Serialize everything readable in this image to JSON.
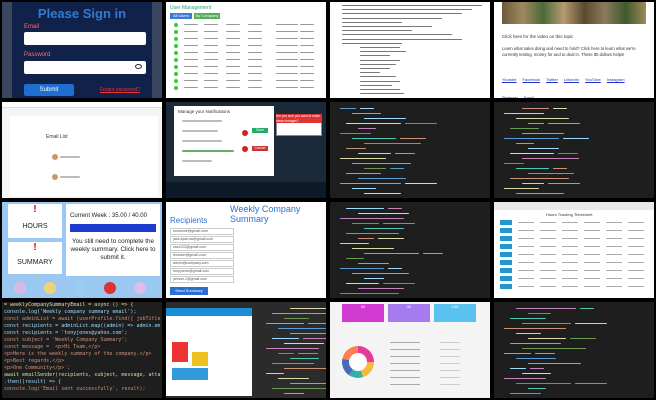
{
  "tiles": {
    "t1": {
      "title": "Please Sign in",
      "email_label": "Email",
      "password_label": "Password",
      "submit": "Submit",
      "link": "Forgot password?"
    },
    "t2": {
      "title": "User Management",
      "tabs": [
        "All Users",
        "By Company"
      ]
    },
    "t4": {
      "caption": "Click here for the video on this topic",
      "body": "Learn what sales doing and need to hold? Click here to learn what we're currently testing, money for and to deal in. These $5 dollars helps!",
      "links": [
        "Youtube",
        "Facebook",
        "Twitter",
        "LinkedIn",
        "YouTube",
        "Instagram",
        "Pinterest",
        "Email"
      ]
    },
    "t5": {
      "title": "Email List"
    },
    "t6": {
      "title": "Manage your Notifications",
      "btn1": "Save",
      "btn2": "Cancel",
      "warning_title": "Are you sure you want to make these changes?"
    },
    "t9": {
      "hours_mark": "!",
      "hours_label": "HOURS",
      "summary_mark": "!",
      "summary_label": "SUMMARY",
      "week_label": "Current Week : 35.00 / 40.00",
      "message": "You still need to complete the weekly summary. Click here to submit it."
    },
    "t10": {
      "title": "Weekly Company Summary",
      "recipients_label": "Recipients",
      "recipients": [
        "someone@gmail.com",
        "jack.sparrow@gmail.com",
        "user123@gmail.com",
        "testuser@gmail.com",
        "admin@company.com",
        "tony.jones@gmail.com",
        "person.1@gmail.com"
      ],
      "send": "Send Summary"
    },
    "t12": {
      "title": "Hours Tracking Timesheet"
    },
    "t13": {
      "code": [
        "= weeklyCompanySummaryEmail = async () => {",
        "console.log('Weekly company summary email');",
        "const adminList = await (userProfile.find({ jobTitle: 'Admi",
        "const recipients = adminList.map((admin) => admin.email);",
        "const recipients = 'tonyjones@yahoo.com';",
        "const subject = 'Weekly Company Summary';",
        "const message = `<p>Hi Team,</p>",
        "<p>Here is the weekly summary of the company.</p>",
        "<p>Best regards,</p>",
        "<p>One Community</p>`;",
        "await emailSender(recipients, subject, message, attachments)",
        ".then((result) => {",
        "  console.log('Email sent successfully', result);"
      ]
    },
    "t15": {
      "cards": [
        "50",
        "40",
        "100"
      ]
    }
  }
}
